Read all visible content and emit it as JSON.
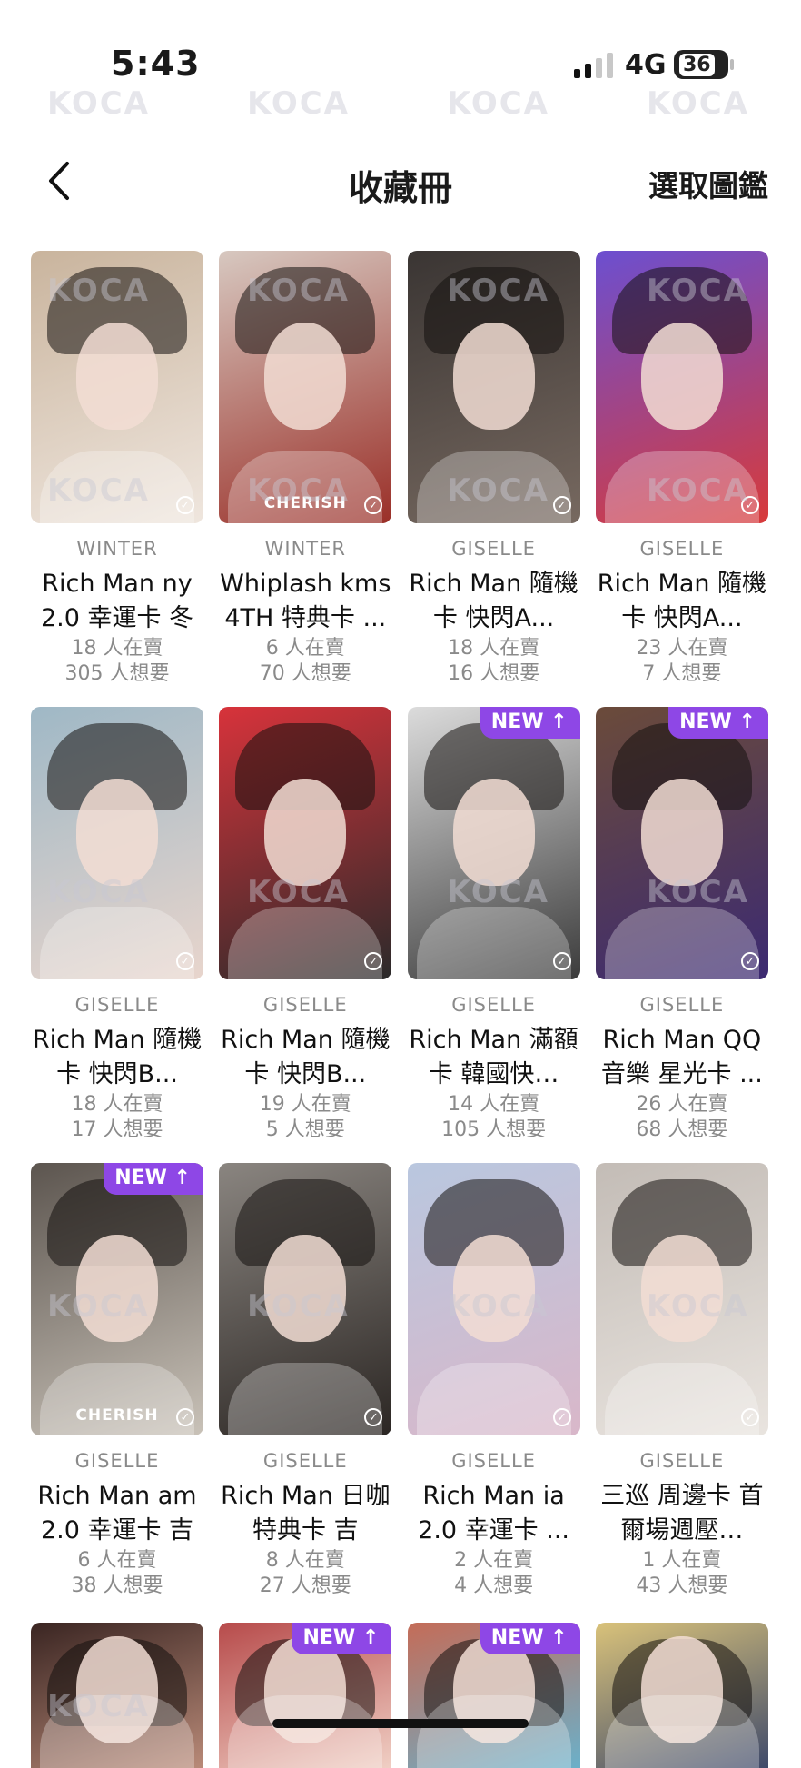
{
  "status_bar": {
    "time": "5:43",
    "network": "4G",
    "battery": "36"
  },
  "nav": {
    "title": "收藏冊",
    "action": "選取圖鑑"
  },
  "watermark": "KOCA",
  "cards": [
    {
      "artist": "WINTER",
      "name": "Rich Man ny 2.0 幸運卡 冬",
      "selling": "18 人在賣",
      "wanting": "305 人想要",
      "new_badge": "",
      "caption": "",
      "colors": [
        "#c9b49d",
        "#efe6de"
      ]
    },
    {
      "artist": "WINTER",
      "name": "Whiplash kms 4TH 特典卡 ...",
      "selling": "6 人在賣",
      "wanting": "70 人想要",
      "new_badge": "",
      "caption": "CHERISH",
      "colors": [
        "#d7c8c0",
        "#9a2f28"
      ]
    },
    {
      "artist": "GISELLE",
      "name": "Rich Man 隨機卡 快閃A...",
      "selling": "18 人在賣",
      "wanting": "16 人想要",
      "new_badge": "",
      "caption": "",
      "colors": [
        "#3a3533",
        "#776960"
      ]
    },
    {
      "artist": "GISELLE",
      "name": "Rich Man 隨機卡 快閃A...",
      "selling": "23 人在賣",
      "wanting": "7 人想要",
      "new_badge": "",
      "caption": "",
      "colors": [
        "#6c4fd0",
        "#d83a3a"
      ]
    },
    {
      "artist": "GISELLE",
      "name": "Rich Man 隨機卡 快閃B...",
      "selling": "18 人在賣",
      "wanting": "17 人想要",
      "new_badge": "",
      "caption": "",
      "colors": [
        "#9fb8c6",
        "#e8d5cc"
      ]
    },
    {
      "artist": "GISELLE",
      "name": "Rich Man 隨機卡 快閃B...",
      "selling": "19 人在賣",
      "wanting": "5 人想要",
      "new_badge": "",
      "caption": "",
      "colors": [
        "#d8333b",
        "#2a2a2a"
      ]
    },
    {
      "artist": "GISELLE",
      "name": "Rich Man 滿額卡 韓國快…",
      "selling": "14 人在賣",
      "wanting": "105 人想要",
      "new_badge": "NEW ↑",
      "caption": "",
      "colors": [
        "#dcdcdc",
        "#3b3b3b"
      ]
    },
    {
      "artist": "GISELLE",
      "name": "Rich Man QQ音樂 星光卡 ...",
      "selling": "26 人在賣",
      "wanting": "68 人想要",
      "new_badge": "NEW ↑",
      "caption": "",
      "colors": [
        "#6b4b3a",
        "#3c2a72"
      ]
    },
    {
      "artist": "GISELLE",
      "name": "Rich Man am 2.0 幸運卡 吉",
      "selling": "6 人在賣",
      "wanting": "38 人想要",
      "new_badge": "NEW ↑",
      "caption": "CHERISH",
      "colors": [
        "#5c554f",
        "#c9c2b8"
      ]
    },
    {
      "artist": "GISELLE",
      "name": "Rich Man 日咖 特典卡 吉",
      "selling": "8 人在賣",
      "wanting": "27 人想要",
      "new_badge": "",
      "caption": "",
      "colors": [
        "#8a8580",
        "#2b2623"
      ]
    },
    {
      "artist": "GISELLE",
      "name": "Rich Man ia 2.0 幸運卡 ...",
      "selling": "2 人在賣",
      "wanting": "4 人想要",
      "new_badge": "",
      "caption": "",
      "colors": [
        "#b9c7df",
        "#d9b7c9"
      ]
    },
    {
      "artist": "GISELLE",
      "name": "三巡 周邊卡 首爾場週壓…",
      "selling": "1 人在賣",
      "wanting": "43 人想要",
      "new_badge": "",
      "caption": "",
      "colors": [
        "#c3bcb6",
        "#e9e4df"
      ]
    }
  ],
  "partial_cards": [
    {
      "new_badge": "",
      "colors": [
        "#3a2522",
        "#b98a78"
      ]
    },
    {
      "new_badge": "NEW ↑",
      "colors": [
        "#b74b4b",
        "#f0cfc4"
      ]
    },
    {
      "new_badge": "NEW ↑",
      "colors": [
        "#c46c58",
        "#6bb0c9"
      ]
    },
    {
      "new_badge": "",
      "colors": [
        "#d9c27a",
        "#3f4a6a"
      ]
    }
  ]
}
